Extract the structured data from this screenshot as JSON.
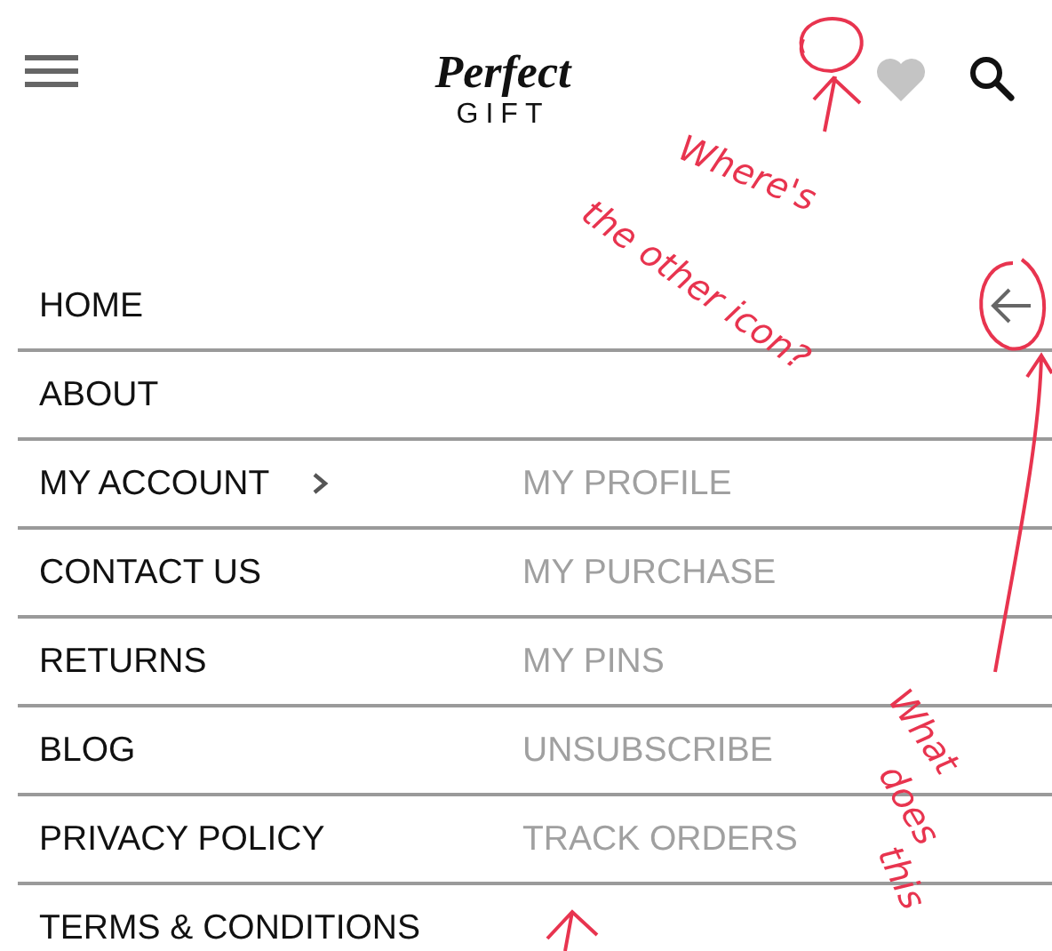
{
  "header": {
    "logo_title": "Perfect",
    "logo_subtitle": "GIFT"
  },
  "menu": [
    {
      "label": "HOME",
      "expanded": false
    },
    {
      "label": "ABOUT",
      "expanded": false
    },
    {
      "label": "MY ACCOUNT",
      "submenu": "MY PROFILE",
      "expanded": true
    },
    {
      "label": "CONTACT US",
      "submenu": "MY PURCHASE",
      "expanded": false
    },
    {
      "label": "RETURNS",
      "submenu": "MY PINS",
      "expanded": false
    },
    {
      "label": "BLOG",
      "submenu": "UNSUBSCRIBE",
      "expanded": false
    },
    {
      "label": "PRIVACY POLICY",
      "submenu": "TRACK ORDERS",
      "expanded": false
    },
    {
      "label": "TERMS & CONDITIONS",
      "expanded": false
    }
  ],
  "annotations": [
    {
      "text": "Where's"
    },
    {
      "text": "the other icon?"
    },
    {
      "text": "What"
    },
    {
      "text": "does"
    },
    {
      "text": "this"
    }
  ]
}
